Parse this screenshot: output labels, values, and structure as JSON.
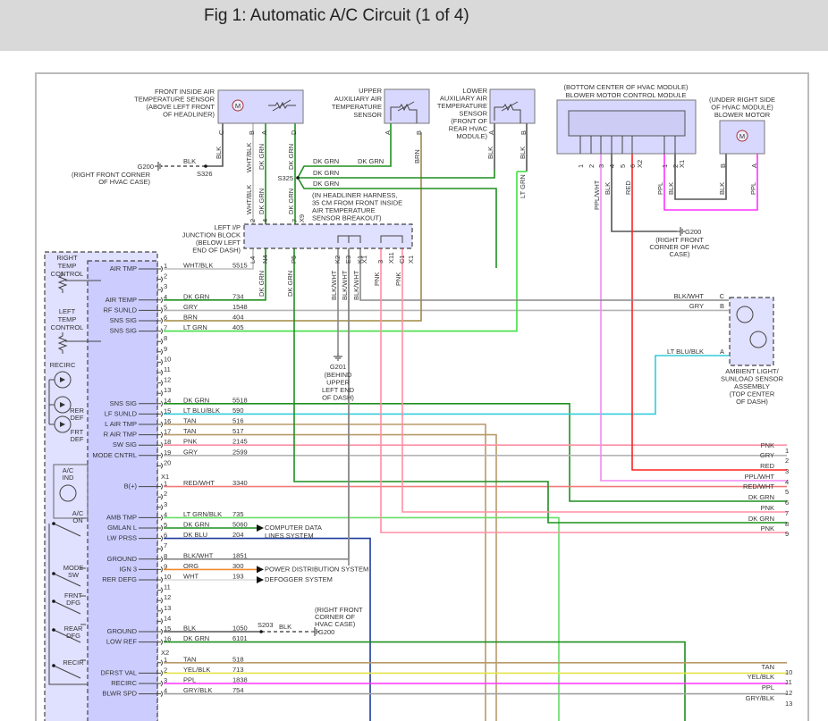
{
  "title": "Fig 1: Automatic A/C Circuit (1 of 4)",
  "colors": {
    "DK GRN": "#1f8f1f",
    "LT GRN": "#44e044",
    "GRY": "#b4b4b4",
    "BRN": "#a08a40",
    "TAN": "#b89a6a",
    "PNK": "#ff8fa3",
    "RED": "#ff2222",
    "RED/WHT": "#f07a7a",
    "PPL/WHT": "#f08af0",
    "PPL": "#ff33ff",
    "LT BLU/BLK": "#33ccdd",
    "DK BLU": "#1f3a9a",
    "ORG": "#f08a30",
    "WHT": "#dcdcdc",
    "YEL/BLK": "#e4e44a",
    "BLK": "#555555",
    "BLK/WHT": "#888888",
    "WHT/BLK": "#bdbdbd",
    "GRY/BLK": "#a0a0a0",
    "LT GRN/BLK": "#66dd66"
  },
  "front_sensor": {
    "label": [
      "FRONT INSIDE AIR",
      "TEMPERATURE SENSOR",
      "(ABOVE LEFT FRONT",
      "OF HEADLINER)"
    ],
    "pins": [
      "C",
      "B",
      "A",
      "D"
    ],
    "wires": [
      "BLK",
      "WHT/BLK",
      "DK GRN",
      "DK GRN"
    ]
  },
  "upper_aux_sensor": {
    "label": [
      "UPPER",
      "AUXILIARY AIR",
      "TEMPERATURE",
      "SENSOR"
    ],
    "pins": [
      "A",
      "B"
    ],
    "wires": [
      "BRN"
    ]
  },
  "lower_aux_sensor": {
    "label": [
      "LOWER",
      "AUXILIARY AIR",
      "TEMPERATURE",
      "SENSOR",
      "(FRONT OF",
      "REAR HVAC",
      "MODULE)"
    ],
    "pins": [
      "A",
      "B"
    ],
    "wires": [
      "BLK",
      "BLK",
      "LT GRN"
    ]
  },
  "blower_module": {
    "label": [
      "(BOTTOM CENTER OF HVAC MODULE)",
      "BLOWER MOTOR CONTROL MODULE"
    ],
    "pins": [
      "1",
      "2",
      "3",
      "4",
      "5",
      "6",
      "X2",
      "1",
      "2",
      "X1"
    ],
    "wires": [
      "PPL/WHT",
      "BLK",
      "RED",
      "PPL",
      "BLK"
    ]
  },
  "blower_motor": {
    "label": [
      "(UNDER RIGHT SIDE",
      "OF HVAC MODULE)",
      "BLOWER MOTOR"
    ],
    "pins": [
      "B",
      "A"
    ],
    "wires": [
      "BLK",
      "PPL"
    ]
  },
  "ground_g200_top": {
    "name": "G200",
    "wire": "BLK",
    "splice": "S326",
    "location": [
      "(RIGHT FRONT CORNER",
      "OF HVAC CASE)"
    ]
  },
  "ground_g200_right": {
    "name": "G200",
    "location": [
      "(RIGHT FRONT",
      "CORNER OF HVAC",
      "CASE)"
    ]
  },
  "splice_s325": {
    "name": "S325",
    "wires": [
      "DK GRN",
      "DK GRN",
      "DK GRN",
      "DK GRN"
    ],
    "note": [
      "(IN HEADLINER HARNESS,",
      "35 CM FROM FRONT INSIDE",
      "AIR TEMPERATURE",
      "SENSOR BREAKOUT)"
    ]
  },
  "junction_block": {
    "label": [
      "LEFT I/P",
      "JUNCTION BLOCK",
      "(BELOW LEFT",
      "END OF DASH)"
    ],
    "top_pins": [
      "2",
      "4",
      "7",
      "X9"
    ],
    "top_wires": [
      "WHT/BLK",
      "DK GRN",
      "DK GRN"
    ],
    "bottom_pins": [
      "L4",
      "N4",
      "P5",
      "K2",
      "E3",
      "K1",
      "X1",
      "3",
      "X11",
      "C1",
      "X1"
    ],
    "bottom_wires": [
      "DK GRN",
      "DK GRN",
      "BLK/WHT",
      "BLK/WHT",
      "BLK/WHT",
      "PNK",
      "PNK"
    ]
  },
  "ground_g201": {
    "name": "G201",
    "location": [
      "(BEHIND",
      "UPPER",
      "LEFT END",
      "OF DASH)"
    ]
  },
  "ambient_sensor": {
    "label": [
      "AMBIENT LIGHT/",
      "SUNLOAD SENSOR",
      "ASSEMBLY",
      "(TOP CENTER",
      "OF DASH)"
    ],
    "pins": [
      {
        "pin": "C",
        "wire": "BLK/WHT"
      },
      {
        "pin": "B",
        "wire": "GRY"
      },
      {
        "pin": "A",
        "wire": "LT BLU/BLK"
      }
    ]
  },
  "hvac_controls": {
    "internal_labels": [
      "RIGHT",
      "TEMP",
      "CONTROL",
      "LEFT",
      "TEMP",
      "CONTROL",
      "RECIRC",
      "RER",
      "DEF",
      "FRT",
      "DEF",
      "A/C",
      "IND",
      "A/C",
      "ON",
      "MODE",
      "SW",
      "FRNT",
      "DFG",
      "REAR",
      "DFG",
      "RECIR"
    ],
    "connectors": [
      {
        "name": "",
        "pins": [
          {
            "num": "1",
            "func": "AIR TMP",
            "wire": "WHT/BLK",
            "circuit": "5515"
          },
          {
            "num": "2"
          },
          {
            "num": "3"
          },
          {
            "num": "4",
            "func": "AIR TEMP",
            "wire": "DK GRN",
            "circuit": "734"
          },
          {
            "num": "5",
            "func": "RF SUNLD",
            "wire": "GRY",
            "circuit": "1548"
          },
          {
            "num": "6",
            "func": "SNS SIG",
            "wire": "BRN",
            "circuit": "404"
          },
          {
            "num": "7",
            "func": "SNS SIG",
            "wire": "LT GRN",
            "circuit": "405"
          },
          {
            "num": "8"
          },
          {
            "num": "9"
          },
          {
            "num": "10"
          },
          {
            "num": "11"
          },
          {
            "num": "12"
          },
          {
            "num": "13"
          },
          {
            "num": "14",
            "func": "SNS SIG",
            "wire": "DK GRN",
            "circuit": "5518"
          },
          {
            "num": "15",
            "func": "LF SUNLD",
            "wire": "LT BLU/BLK",
            "circuit": "590"
          },
          {
            "num": "16",
            "func": "L AIR TMP",
            "wire": "TAN",
            "circuit": "516"
          },
          {
            "num": "17",
            "func": "R AIR TMP",
            "wire": "TAN",
            "circuit": "517"
          },
          {
            "num": "18",
            "func": "SW SIG",
            "wire": "PNK",
            "circuit": "2145"
          },
          {
            "num": "19",
            "func": "MODE CNTRL",
            "wire": "GRY",
            "circuit": "2599"
          },
          {
            "num": "20"
          }
        ]
      },
      {
        "name": "X1",
        "pins": [
          {
            "num": "1",
            "func": "B(+)",
            "wire": "RED/WHT",
            "circuit": "3340"
          },
          {
            "num": "2"
          },
          {
            "num": "3"
          },
          {
            "num": "4",
            "func": "AMB TMP",
            "wire": "LT GRN/BLK",
            "circuit": "735"
          },
          {
            "num": "5",
            "func": "GMLAN L",
            "wire": "DK GRN",
            "circuit": "5060",
            "dest": [
              "COMPUTER DATA",
              "LINES SYSTEM"
            ]
          },
          {
            "num": "6",
            "func": "LW PRSS",
            "wire": "DK BLU",
            "circuit": "204"
          },
          {
            "num": "7"
          },
          {
            "num": "8",
            "func": "GROUND",
            "wire": "BLK/WHT",
            "circuit": "1851"
          },
          {
            "num": "9",
            "func": "IGN 3",
            "wire": "ORG",
            "circuit": "300",
            "dest": [
              "POWER DISTRIBUTION SYSTEM"
            ]
          },
          {
            "num": "10",
            "func": "RER DEFG",
            "wire": "WHT",
            "circuit": "193",
            "dest": [
              "DEFOGGER SYSTEM"
            ]
          },
          {
            "num": "11"
          },
          {
            "num": "12"
          },
          {
            "num": "13"
          },
          {
            "num": "14"
          },
          {
            "num": "15",
            "func": "GROUND",
            "wire": "BLK",
            "circuit": "1050",
            "splice": "S203",
            "ground": "G200",
            "ground_wire": "BLK",
            "location": [
              "(RIGHT FRONT",
              "CORNER OF",
              "HVAC CASE)"
            ]
          },
          {
            "num": "16",
            "func": "LOW REF",
            "wire": "DK GRN",
            "circuit": "6101"
          }
        ]
      },
      {
        "name": "X2",
        "pins": [
          {
            "num": "1",
            "wire": "TAN",
            "circuit": "518"
          },
          {
            "num": "2",
            "func": "DFRST VAL",
            "wire": "YEL/BLK",
            "circuit": "713"
          },
          {
            "num": "3",
            "func": "RECIRC",
            "wire": "PPL",
            "circuit": "1838"
          },
          {
            "num": "4",
            "func": "BLWR SPD",
            "wire": "GRY/BLK",
            "circuit": "754"
          }
        ]
      }
    ]
  },
  "right_connector": [
    {
      "num": "1",
      "wire": "PNK"
    },
    {
      "num": "2",
      "wire": "GRY"
    },
    {
      "num": "3",
      "wire": "RED"
    },
    {
      "num": "4",
      "wire": "PPL/WHT"
    },
    {
      "num": "5",
      "wire": "RED/WHT"
    },
    {
      "num": "6",
      "wire": "DK GRN"
    },
    {
      "num": "7",
      "wire": "PNK"
    },
    {
      "num": "8",
      "wire": "DK GRN"
    },
    {
      "num": "9",
      "wire": "PNK"
    },
    {
      "num": "10",
      "wire": "TAN"
    },
    {
      "num": "11",
      "wire": "YEL/BLK"
    },
    {
      "num": "12",
      "wire": "PPL"
    },
    {
      "num": "13",
      "wire": "GRY/BLK"
    }
  ]
}
